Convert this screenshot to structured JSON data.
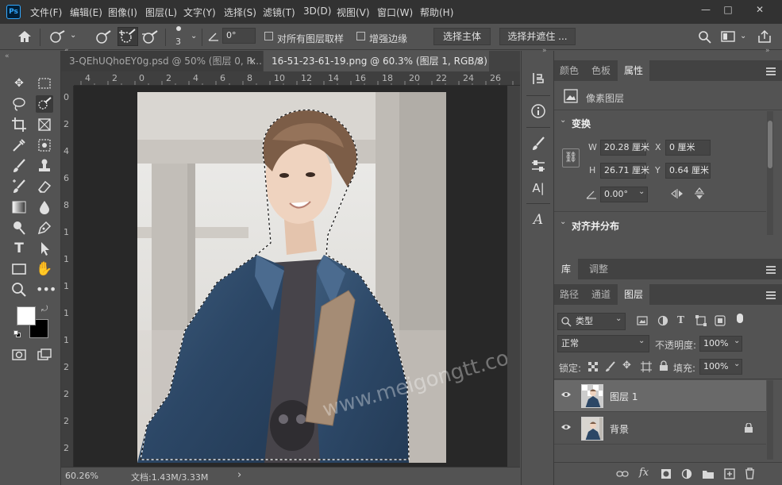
{
  "app": {
    "logo": "Ps"
  },
  "menu": [
    "文件(F)",
    "编辑(E)",
    "图像(I)",
    "图层(L)",
    "文字(Y)",
    "选择(S)",
    "滤镜(T)",
    "3D(D)",
    "视图(V)",
    "窗口(W)",
    "帮助(H)"
  ],
  "window_controls": {
    "minimize": "—",
    "maximize": "□",
    "close": "✕"
  },
  "options": {
    "brush_size": "3",
    "angle": "0°",
    "sample_all_layers": "对所有图层取样",
    "enhance_edge": "增强边缘",
    "select_subject": "选择主体",
    "select_and_mask": "选择并遮住 ..."
  },
  "tabs": [
    {
      "label": "3-QEhUQhoEY0g.psd @ 50% (图层 0, R...",
      "close": "×"
    },
    {
      "label": "16-51-23-61-19.png @ 60.3% (图层 1, RGB/8) *",
      "close": "×"
    }
  ],
  "ruler_h": [
    "4",
    "2",
    "0",
    "2",
    "4",
    "6",
    "8",
    "10",
    "12",
    "14",
    "16",
    "18",
    "20",
    "22",
    "24",
    "26"
  ],
  "ruler_v": [
    "0",
    "2",
    "4",
    "6",
    "8",
    "1",
    "1",
    "1",
    "1",
    "1",
    "2",
    "2",
    "2",
    "2"
  ],
  "status": {
    "zoom": "60.26%",
    "doc": "文档:1.43M/3.33M",
    "arrow": "›"
  },
  "watermark": "www.meigongtt.com",
  "colors": {
    "foreground": "#ffffff",
    "background": "#000000",
    "accent": "#31a8ff"
  },
  "properties": {
    "tabs": [
      "颜色",
      "色板",
      "属性"
    ],
    "active_tab": "属性",
    "layer_type": "像素图层",
    "transform_title": "变换",
    "w_label": "W",
    "w_value": "20.28 厘米",
    "h_label": "H",
    "h_value": "26.71 厘米",
    "x_label": "X",
    "x_value": "0 厘米",
    "y_label": "Y",
    "y_value": "0.64 厘米",
    "angle_value": "0.00°",
    "align_title": "对齐并分布"
  },
  "library_tabs": [
    "库",
    "调整"
  ],
  "layers_panel": {
    "tabs": [
      "路径",
      "通道",
      "图层"
    ],
    "active_tab": "图层",
    "filter_kind": "类型",
    "blend_mode": "正常",
    "opacity_label": "不透明度:",
    "opacity_value": "100%",
    "lock_label": "锁定:",
    "fill_label": "填充:",
    "fill_value": "100%",
    "layers": [
      {
        "name": "图层 1",
        "selected": true
      },
      {
        "name": "背景",
        "selected": false
      }
    ]
  }
}
